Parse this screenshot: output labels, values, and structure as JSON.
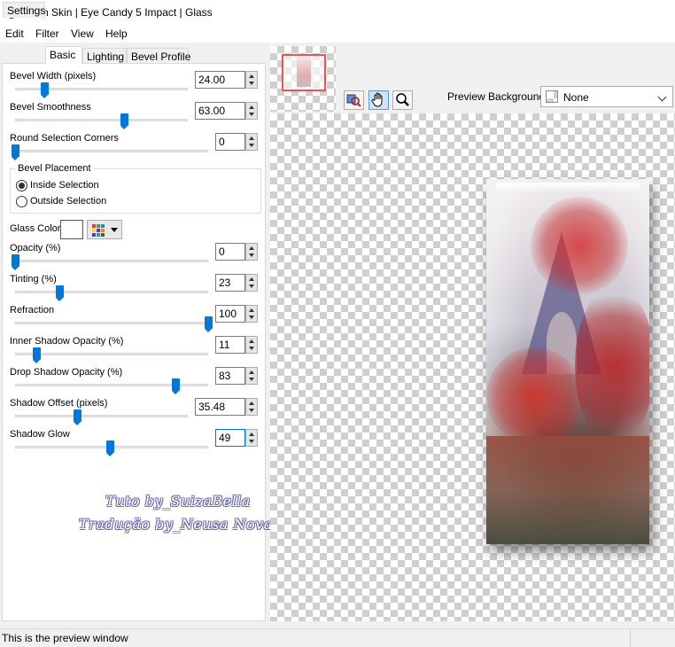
{
  "window": {
    "title": "Alien Skin | Eye Candy 5 Impact | Glass"
  },
  "menu": [
    "Edit",
    "Filter",
    "View",
    "Help"
  ],
  "tabs": [
    "Settings",
    "Basic",
    "Lighting",
    "Bevel Profile"
  ],
  "active_tab": "Basic",
  "controls": {
    "bevel_width": {
      "label": "Bevel Width (pixels)",
      "value": "24.00",
      "level": 0.17
    },
    "bevel_smoothness": {
      "label": "Bevel Smoothness",
      "value": "63.00",
      "level": 0.63
    },
    "round_corners": {
      "label": "Round Selection Corners",
      "value": "0",
      "level": 0.0
    },
    "bevel_placement": {
      "label": "Bevel Placement",
      "options": [
        "Inside Selection",
        "Outside Selection"
      ],
      "selected": "Inside Selection"
    },
    "glass_color": {
      "label": "Glass Color",
      "color": "#ffffff"
    },
    "opacity": {
      "label": "Opacity (%)",
      "value": "0",
      "level": 0.0
    },
    "tinting": {
      "label": "Tinting (%)",
      "value": "23",
      "level": 0.23
    },
    "refraction": {
      "label": "Refraction",
      "value": "100",
      "level": 1.0
    },
    "inner_shadow_opacity": {
      "label": "Inner Shadow Opacity (%)",
      "value": "11",
      "level": 0.11
    },
    "drop_shadow_opacity": {
      "label": "Drop Shadow Opacity (%)",
      "value": "83",
      "level": 0.83
    },
    "shadow_offset": {
      "label": "Shadow Offset (pixels)",
      "value": "35.48",
      "level": 0.36
    },
    "shadow_glow": {
      "label": "Shadow Glow",
      "value": "49",
      "level": 0.49
    }
  },
  "watermark": [
    "Tuto by_SuizaBella",
    "Tradução by_Neusa Novaes"
  ],
  "preview": {
    "background_label": "Preview Background:",
    "background_value": "None",
    "tools": [
      "navigate-tool",
      "hand-tool",
      "zoom-tool"
    ]
  },
  "status": {
    "text": "This is the preview window"
  },
  "colors": {
    "accent": "#0078d7",
    "nav_frame": "#e8535e"
  }
}
